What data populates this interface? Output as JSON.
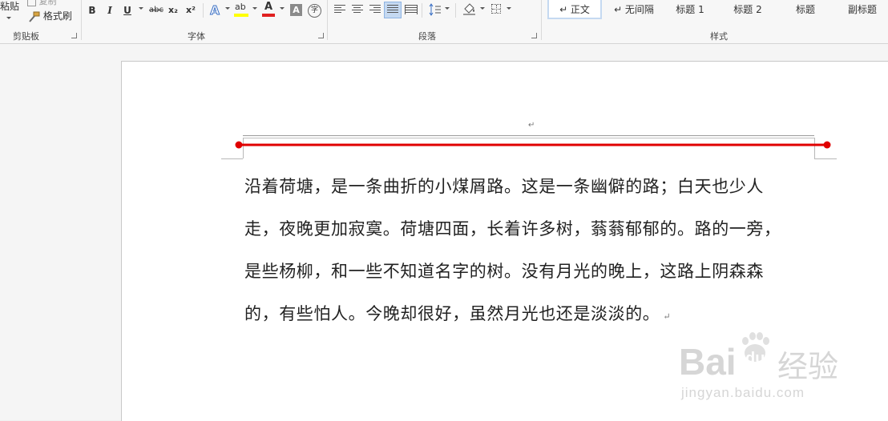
{
  "ribbon": {
    "clipboard": {
      "paste_label": "粘贴",
      "copy_label": "复制",
      "format_painter_label": "格式刷",
      "group_label": "剪贴板"
    },
    "font": {
      "group_label": "字体",
      "bold": "B",
      "italic": "I",
      "underline": "U",
      "strike": "abc",
      "subscript": "x₂",
      "superscript": "x²",
      "text_effect": "A",
      "highlight": "ab",
      "font_color": "A",
      "char_shading": "A",
      "enclose": "字",
      "highlight_color": "#ffff00",
      "font_color_value": "#e02020"
    },
    "paragraph": {
      "group_label": "段落"
    },
    "styles": {
      "group_label": "样式",
      "items": [
        {
          "label": "↵ 正文"
        },
        {
          "label": "↵ 无间隔"
        },
        {
          "label": "标题 1"
        },
        {
          "label": "标题 2"
        },
        {
          "label": "标题"
        },
        {
          "label": "副标题"
        }
      ]
    }
  },
  "document": {
    "paragraph_mark": "↵",
    "body_lines": [
      "沿着荷塘，是一条曲折的小煤屑路。这是一条幽僻的路；白天也少人",
      "走，夜晚更加寂寞。荷塘四面，长着许多树，蓊蓊郁郁的。路的一旁，",
      "是些杨柳，和一些不知道名字的树。没有月光的晚上，这路上阴森森",
      "的，有些怕人。今晚却很好，虽然月光也还是淡淡的。"
    ],
    "annotation_line_color": "#e00000"
  },
  "watermark": {
    "brand": "Bai",
    "paw": "du",
    "chinese": "经验",
    "url": "jingyan.baidu.com"
  }
}
